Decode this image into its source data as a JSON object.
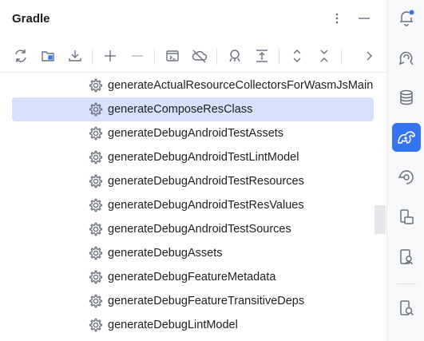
{
  "panel": {
    "title": "Gradle",
    "header_icons": [
      "more-vertical-icon",
      "minimize-icon"
    ]
  },
  "toolbar": {
    "buttons": [
      "reload-icon",
      "link-project-icon",
      "download-sources-icon",
      "add-icon",
      "remove-icon",
      "run-task-icon",
      "offline-mode-icon",
      "analyze-dependencies-icon",
      "expand-all-icon",
      "expand-icon",
      "collapse-icon",
      "more-chevron-icon"
    ]
  },
  "tasks": [
    {
      "label": "generateActualResourceCollectorsForWasmJsMain",
      "selected": false
    },
    {
      "label": "generateComposeResClass",
      "selected": true
    },
    {
      "label": "generateDebugAndroidTestAssets",
      "selected": false
    },
    {
      "label": "generateDebugAndroidTestLintModel",
      "selected": false
    },
    {
      "label": "generateDebugAndroidTestResources",
      "selected": false
    },
    {
      "label": "generateDebugAndroidTestResValues",
      "selected": false
    },
    {
      "label": "generateDebugAndroidTestSources",
      "selected": false
    },
    {
      "label": "generateDebugAssets",
      "selected": false
    },
    {
      "label": "generateDebugFeatureMetadata",
      "selected": false
    },
    {
      "label": "generateDebugFeatureTransitiveDeps",
      "selected": false
    },
    {
      "label": "generateDebugLintModel",
      "selected": false
    }
  ],
  "sidebar": {
    "items": [
      "notifications-icon",
      "ai-assistant-icon",
      "database-icon",
      "gradle-icon",
      "build-variants-icon",
      "device-manager-icon",
      "running-devices-icon",
      "app-inspection-icon"
    ],
    "active": "gradle-icon",
    "accent": "#3574f0",
    "badge_color": "#3574f0"
  },
  "colors": {
    "selection": "#d5e1fd",
    "icon": "#6c707e"
  }
}
